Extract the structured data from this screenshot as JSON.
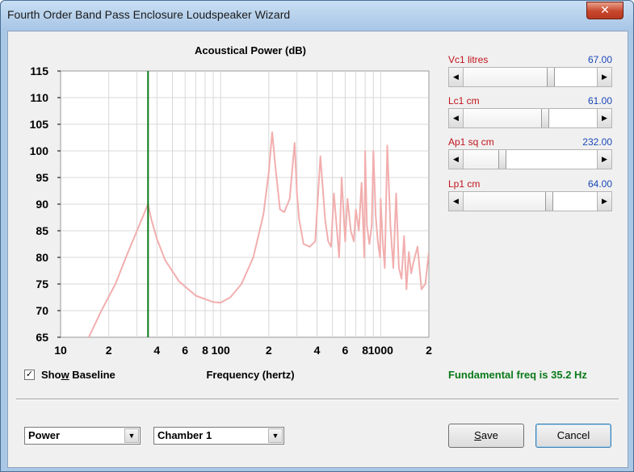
{
  "window": {
    "title": "Fourth Order Band Pass Enclosure Loudspeaker Wizard",
    "close_glyph": "✕"
  },
  "chart": {
    "title": "Acoustical Power (dB)",
    "xlabel": "Frequency (hertz)",
    "y_ticks": [
      "115",
      "110",
      "105",
      "100",
      "95",
      "90",
      "85",
      "80",
      "75",
      "70",
      "65"
    ],
    "x_tick_labels": [
      {
        "f": 10,
        "label": "10"
      },
      {
        "f": 20,
        "label": "2"
      },
      {
        "f": 40,
        "label": "4"
      },
      {
        "f": 60,
        "label": "6"
      },
      {
        "f": 80,
        "label": "8"
      },
      {
        "f": 100,
        "label": "100"
      },
      {
        "f": 200,
        "label": "2"
      },
      {
        "f": 400,
        "label": "4"
      },
      {
        "f": 600,
        "label": "6"
      },
      {
        "f": 800,
        "label": "8"
      },
      {
        "f": 1000,
        "label": "1000"
      },
      {
        "f": 2000,
        "label": "2"
      }
    ],
    "colors": {
      "curve": "#f2aeae",
      "marker": "#0b7a1a",
      "grid": "#d8d8d8"
    }
  },
  "chart_data": {
    "type": "line",
    "title": "Acoustical Power (dB)",
    "xlabel": "Frequency (hertz)",
    "ylabel": "",
    "xscale": "log",
    "xlim": [
      10,
      2000
    ],
    "ylim": [
      65,
      115
    ],
    "grid": true,
    "marker_line_x": 35.2,
    "series": [
      {
        "x": [
          15,
          18,
          22,
          26,
          30,
          33,
          35.2,
          37,
          40,
          45,
          55,
          70,
          90,
          100,
          115,
          135,
          160,
          185,
          200,
          210,
          220,
          235,
          250,
          270,
          290,
          300,
          310,
          330,
          360,
          390,
          420,
          450,
          470,
          490,
          510,
          530,
          550,
          570,
          590,
          600,
          620,
          650,
          680,
          700,
          730,
          760,
          790,
          800,
          820,
          850,
          880,
          900,
          930,
          960,
          990,
          1000,
          1030,
          1060,
          1100,
          1150,
          1200,
          1250,
          1300,
          1350,
          1400,
          1450,
          1500,
          1550,
          1600,
          1700,
          1800,
          1900,
          2000
        ],
        "y": [
          65,
          70,
          75,
          80.5,
          85,
          88,
          90,
          87,
          83.5,
          79.5,
          75.5,
          72.8,
          71.6,
          71.5,
          72.5,
          75,
          80,
          88,
          96,
          103.5,
          97,
          89,
          88.5,
          91,
          101.5,
          92,
          87,
          82.5,
          82,
          83,
          99,
          87,
          83,
          82,
          92,
          86,
          80,
          95,
          87,
          83,
          91,
          85,
          83,
          89,
          85,
          94,
          80,
          100,
          86,
          82.5,
          86,
          100,
          88,
          83,
          80,
          91,
          83,
          78,
          101,
          86,
          78,
          92,
          78,
          76,
          84,
          74,
          81,
          77,
          79,
          82,
          74,
          75,
          81
        ]
      }
    ]
  },
  "options": {
    "show_baseline": "Show Baseline",
    "fundamental": "Fundamental freq is 35.2 Hz"
  },
  "sliders": [
    {
      "label": "Vc1  litres",
      "value": "67.00",
      "level": 0.667
    },
    {
      "label": "Lc1  cm",
      "value": "61.00",
      "level": 0.617
    },
    {
      "label": "Ap1  sq cm",
      "value": "232.00",
      "level": 0.276
    },
    {
      "label": "Lp1  cm",
      "value": "64.00",
      "level": 0.65
    }
  ],
  "controls": {
    "combo1": "Power",
    "combo2": "Chamber 1",
    "save": "Save",
    "cancel": "Cancel",
    "left_arrow": "◀",
    "right_arrow": "▶",
    "down_arrow": "▼",
    "check_mark": "✓"
  }
}
